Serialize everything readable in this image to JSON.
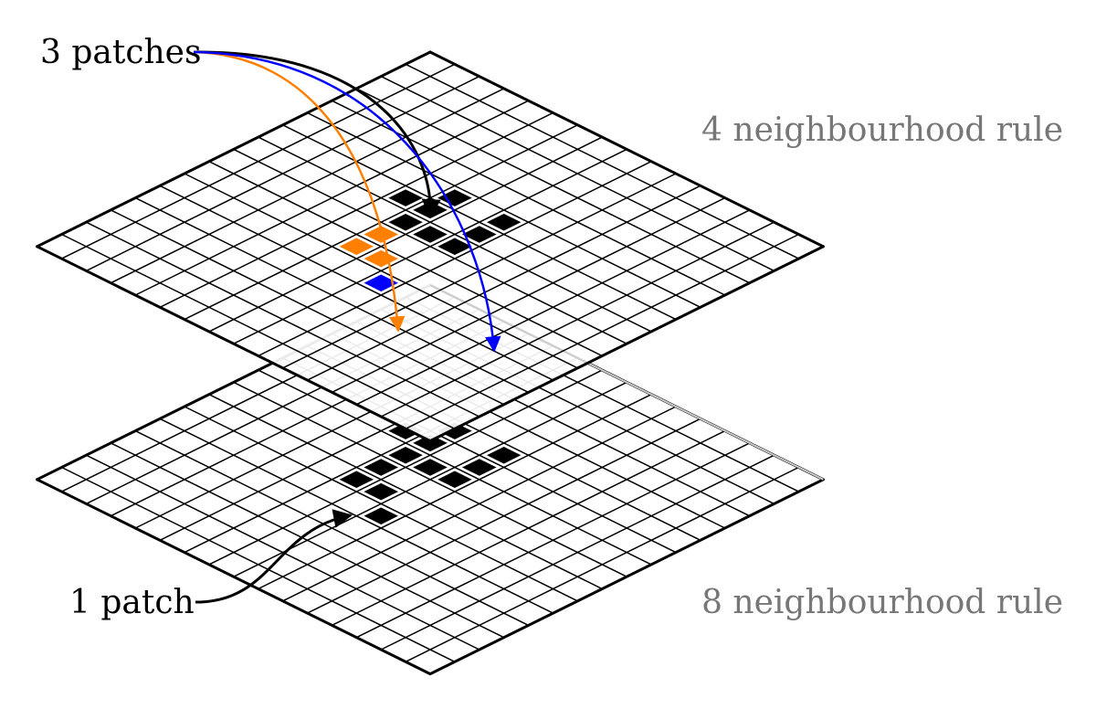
{
  "labels": {
    "top_patches": "3 patches",
    "bottom_patches": "1 patch",
    "top_rule": "4 neighbourhood rule",
    "bottom_rule": "8 neighbourhood rule"
  },
  "grid": {
    "rows": 16,
    "cols": 16
  },
  "top_grid": {
    "black_cells": [
      [
        5,
        6
      ],
      [
        6,
        5
      ],
      [
        6,
        6
      ],
      [
        7,
        6
      ],
      [
        7,
        7
      ],
      [
        5,
        8
      ],
      [
        6,
        8
      ],
      [
        7,
        8
      ]
    ],
    "orange_cells": [
      [
        8,
        6
      ],
      [
        9,
        6
      ],
      [
        9,
        7
      ]
    ],
    "blue_cells": [
      [
        10,
        8
      ]
    ]
  },
  "bottom_grid": {
    "black_cells": [
      [
        5,
        6
      ],
      [
        6,
        5
      ],
      [
        6,
        6
      ],
      [
        7,
        6
      ],
      [
        7,
        7
      ],
      [
        5,
        8
      ],
      [
        6,
        8
      ],
      [
        7,
        8
      ],
      [
        8,
        6
      ],
      [
        9,
        6
      ],
      [
        9,
        7
      ],
      [
        10,
        8
      ]
    ]
  },
  "colors": {
    "black_patch": "#000000",
    "orange_patch": "#ff7f00",
    "blue_patch": "#0000ff",
    "grid_line": "#000000",
    "hidden_grid_line": "#cccccc",
    "rule_label": "#777777"
  },
  "icons": {
    "top_label_arrows": [
      "black-arrow-icon",
      "orange-arrow-icon",
      "blue-arrow-icon"
    ],
    "bottom_label_arrow": "black-arrow-icon"
  }
}
